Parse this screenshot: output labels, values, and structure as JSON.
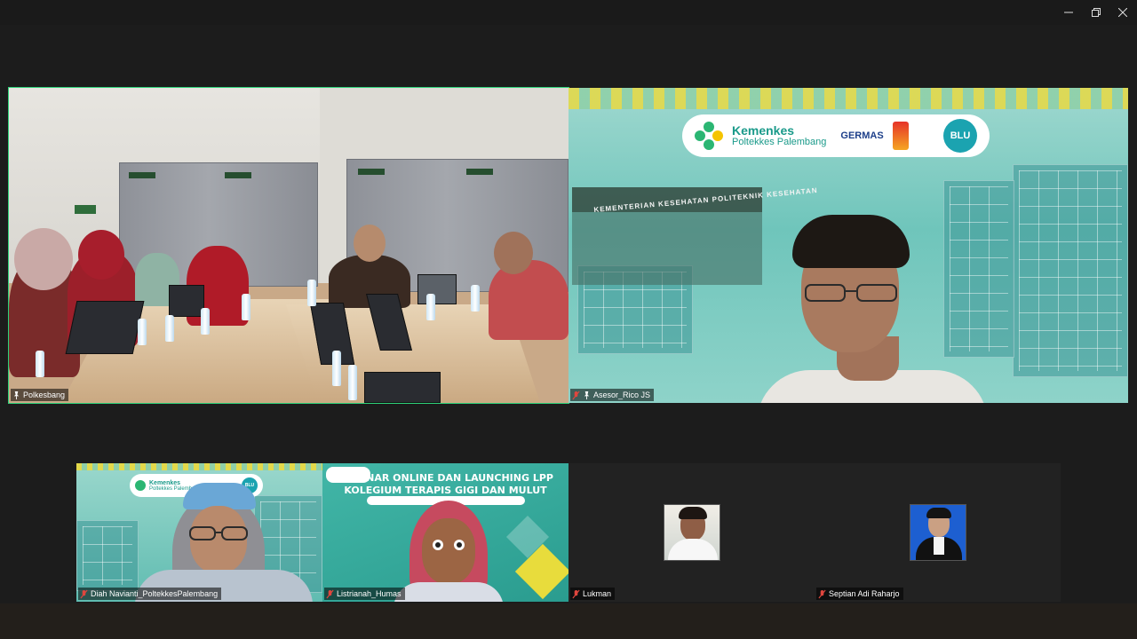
{
  "window": {
    "controls": {
      "minimize": "—",
      "restore": "❐",
      "close": "✕"
    }
  },
  "tiles": {
    "polkesbang": {
      "name": "Polkesbang",
      "cabinet_labels": [
        "KRITERIA V",
        "KRITERIA VI",
        "KRITERIA VII",
        "KRITERIA VIII"
      ]
    },
    "rico": {
      "name": "Asesor_Rico JS",
      "logo_title": "Kemenkes",
      "logo_subtitle": "Poltekkes Palembang",
      "germas": "GERMAS",
      "blu": "BLU",
      "gate_text": "KEMENTERIAN KESEHATAN POLITEKNIK KESEHATAN"
    },
    "diah": {
      "name": "Diah Navianti_PoltekkesPalembang",
      "logo_title": "Kemenkes",
      "logo_subtitle": "Poltekkes Palembang",
      "blu": "BLU"
    },
    "listrianah": {
      "name": "Listrianah_Humas",
      "title_line1": "WEBINAR ONLINE DAN LAUNCHING LPP",
      "title_line2": "KOLEGIUM TERAPIS GIGI DAN MULUT"
    },
    "lukman": {
      "name": "Lukman"
    },
    "septian": {
      "name": "Septian Adi Raharjo"
    }
  },
  "colors": {
    "active_outline": "#2ed37a",
    "kemenkes_teal": "#1a9a8a",
    "muted_mic": "#e0463e"
  },
  "icons": {
    "muted_mic": "mic-off-icon",
    "pin": "pin-icon"
  }
}
